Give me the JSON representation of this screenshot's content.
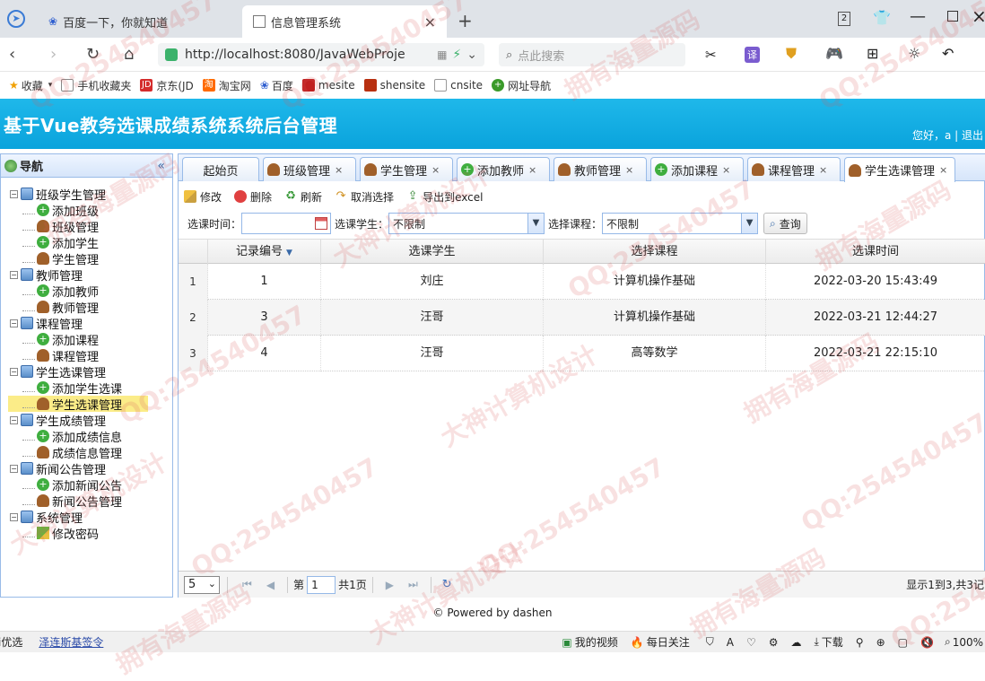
{
  "browser": {
    "tabs": [
      {
        "label": "百度一下，你就知道"
      },
      {
        "label": "信息管理系统"
      }
    ],
    "url": "http://localhost:8080/JavaWebProje",
    "search_placeholder": "点此搜索",
    "tab_count": "2",
    "bookmarks": [
      {
        "label": "收藏",
        "icon": "star-icon"
      },
      {
        "label": "手机收藏夹",
        "icon": "phone-icon"
      },
      {
        "label": "京东(JD",
        "icon": "jd-icon"
      },
      {
        "label": "淘宝网",
        "icon": "taobao-icon"
      },
      {
        "label": "百度",
        "icon": "baidu-icon"
      },
      {
        "label": "mesite",
        "icon": "mesite-icon"
      },
      {
        "label": "shensite",
        "icon": "shensite-icon"
      },
      {
        "label": "cnsite",
        "icon": "page-icon"
      },
      {
        "label": "网址导航",
        "icon": "nav-icon"
      }
    ]
  },
  "app": {
    "title": "基于Vue教务选课成绩系统系统后台管理",
    "welcome": "您好，a | 退出"
  },
  "nav": {
    "title": "导航",
    "collapse": "«",
    "items": [
      {
        "label": "班级学生管理",
        "level": 0
      },
      {
        "label": "添加班级",
        "level": 1,
        "icon": "plus"
      },
      {
        "label": "班级管理",
        "level": 1,
        "icon": "user"
      },
      {
        "label": "添加学生",
        "level": 1,
        "icon": "plus"
      },
      {
        "label": "学生管理",
        "level": 1,
        "icon": "user"
      },
      {
        "label": "教师管理",
        "level": 0
      },
      {
        "label": "添加教师",
        "level": 1,
        "icon": "plus"
      },
      {
        "label": "教师管理",
        "level": 1,
        "icon": "user"
      },
      {
        "label": "课程管理",
        "level": 0
      },
      {
        "label": "添加课程",
        "level": 1,
        "icon": "plus"
      },
      {
        "label": "课程管理",
        "level": 1,
        "icon": "user"
      },
      {
        "label": "学生选课管理",
        "level": 0
      },
      {
        "label": "添加学生选课",
        "level": 1,
        "icon": "plus"
      },
      {
        "label": "学生选课管理",
        "level": 1,
        "icon": "user",
        "selected": true
      },
      {
        "label": "学生成绩管理",
        "level": 0
      },
      {
        "label": "添加成绩信息",
        "level": 1,
        "icon": "plus"
      },
      {
        "label": "成绩信息管理",
        "level": 1,
        "icon": "user"
      },
      {
        "label": "新闻公告管理",
        "level": 0
      },
      {
        "label": "添加新闻公告",
        "level": 1,
        "icon": "plus"
      },
      {
        "label": "新闻公告管理",
        "level": 1,
        "icon": "user"
      },
      {
        "label": "系统管理",
        "level": 0
      },
      {
        "label": "修改密码",
        "level": 1,
        "icon": "pen"
      }
    ]
  },
  "tabs": [
    {
      "label": "起始页",
      "closable": false
    },
    {
      "label": "班级管理",
      "icon": "user",
      "closable": true
    },
    {
      "label": "学生管理",
      "icon": "user",
      "closable": true
    },
    {
      "label": "添加教师",
      "icon": "plus",
      "closable": true
    },
    {
      "label": "教师管理",
      "icon": "user",
      "closable": true
    },
    {
      "label": "添加课程",
      "icon": "plus",
      "closable": true
    },
    {
      "label": "课程管理",
      "icon": "user",
      "closable": true
    },
    {
      "label": "学生选课管理",
      "icon": "user",
      "closable": true,
      "active": true
    }
  ],
  "toolbar": {
    "edit": "修改",
    "delete": "删除",
    "refresh": "刷新",
    "cancel": "取消选择",
    "export": "导出到excel"
  },
  "filters": {
    "time_label": "选课时间：",
    "student_label": "选课学生：",
    "student_value": "不限制",
    "course_label": "选择课程：",
    "course_value": "不限制",
    "query": "查询"
  },
  "grid": {
    "columns": [
      "记录编号",
      "选课学生",
      "选择课程",
      "选课时间"
    ],
    "rows": [
      {
        "n": "1",
        "id": "1",
        "student": "刘庄",
        "course": "计算机操作基础",
        "time": "2022-03-20 15:43:49"
      },
      {
        "n": "2",
        "id": "3",
        "student": "汪哥",
        "course": "计算机操作基础",
        "time": "2022-03-21 12:44:27"
      },
      {
        "n": "3",
        "id": "4",
        "student": "汪哥",
        "course": "高等数学",
        "time": "2022-03-21 22:15:10"
      }
    ]
  },
  "pager": {
    "page_size": "5",
    "page_prefix": "第",
    "page": "1",
    "page_total": "共1页",
    "summary": "显示1到3,共3记"
  },
  "footer": "© Powered by dashen",
  "statusbar": {
    "left": "i优选",
    "ticker": "泽连斯基签令",
    "video": "我的视频",
    "daily": "每日关注",
    "download": "下载",
    "zoom": "100%"
  },
  "watermark": [
    "QQ:254540457",
    "拥有海量源码",
    "大神计算机设计"
  ]
}
